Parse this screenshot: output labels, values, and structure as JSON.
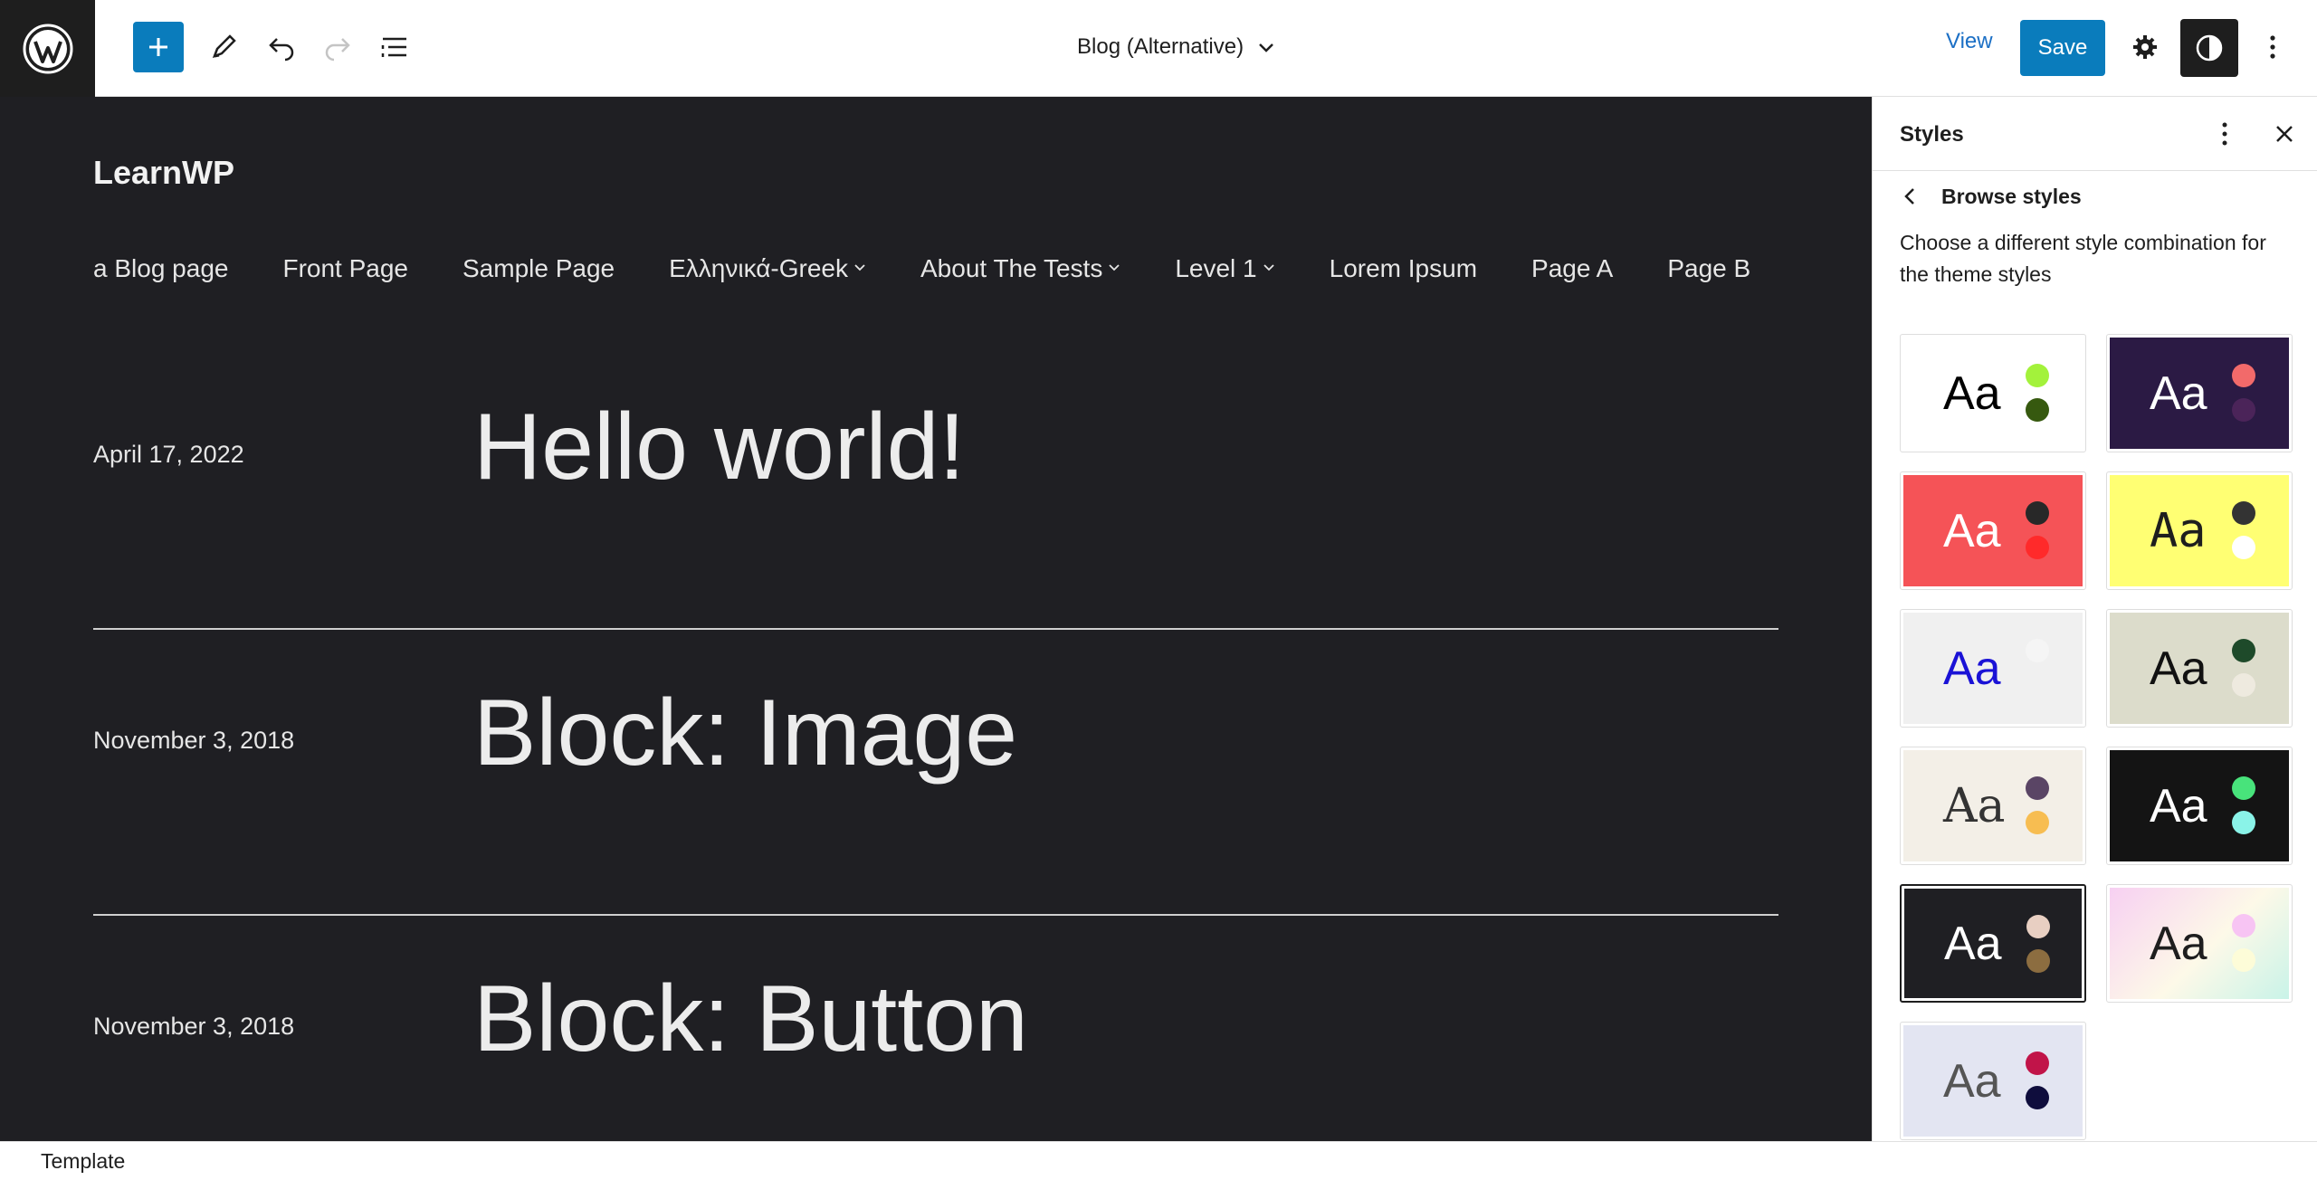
{
  "toolbar": {
    "document_title": "Blog (Alternative)",
    "view_label": "View",
    "save_label": "Save"
  },
  "site": {
    "title": "LearnWP",
    "nav": [
      {
        "label": "a Blog page",
        "has_submenu": false
      },
      {
        "label": "Front Page",
        "has_submenu": false
      },
      {
        "label": "Sample Page",
        "has_submenu": false
      },
      {
        "label": "Ελληνικά-Greek",
        "has_submenu": true
      },
      {
        "label": "About The Tests",
        "has_submenu": true
      },
      {
        "label": "Level 1",
        "has_submenu": true
      },
      {
        "label": "Lorem Ipsum",
        "has_submenu": false
      },
      {
        "label": "Page A",
        "has_submenu": false
      },
      {
        "label": "Page B",
        "has_submenu": false
      }
    ],
    "posts": [
      {
        "date": "April 17, 2022",
        "title": "Hello world!"
      },
      {
        "date": "November 3, 2018",
        "title": "Block: Image"
      },
      {
        "date": "November 3, 2018",
        "title": "Block: Button"
      }
    ]
  },
  "sidebar": {
    "title": "Styles",
    "subheading": "Browse styles",
    "description": "Choose a different style combination for the theme styles",
    "variations": [
      {
        "aa": "Aa",
        "bg": "#ffffff",
        "text": "#000000",
        "dot1": "#a3f23b",
        "dot2": "#36590f",
        "serif": false,
        "selected": false
      },
      {
        "aa": "Aa",
        "bg": "#2b1a44",
        "text": "#ffffff",
        "dot1": "#f26a6a",
        "dot2": "#4b2459",
        "serif": false,
        "selected": false
      },
      {
        "aa": "Aa",
        "bg": "#f55357",
        "text": "#ffffff",
        "dot1": "#282828",
        "dot2": "#ff2a2a",
        "serif": false,
        "selected": false
      },
      {
        "aa": "Aa",
        "bg": "#ffff73",
        "text": "#1e1e1e",
        "dot1": "#333333",
        "dot2": "#ffffff",
        "serif": false,
        "mono": true,
        "selected": false
      },
      {
        "aa": "Aa",
        "bg": "#f0f0f0",
        "text": "#1a12d6",
        "dot1": "#f5f5f5",
        "dot2": "#f0f0f0",
        "serif": false,
        "selected": false
      },
      {
        "aa": "Aa",
        "bg": "#dcdccb",
        "text": "#111111",
        "dot1": "#1e4a2a",
        "dot2": "#eeeadf",
        "serif": false,
        "selected": false
      },
      {
        "aa": "Aa",
        "bg": "#f3efe7",
        "text": "#333333",
        "dot1": "#5a4565",
        "dot2": "#f7bd51",
        "serif": true,
        "selected": false
      },
      {
        "aa": "Aa",
        "bg": "#141414",
        "text": "#ffffff",
        "dot1": "#48e37b",
        "dot2": "#8af3e8",
        "serif": false,
        "selected": false
      },
      {
        "aa": "Aa",
        "bg": "#1f1f23",
        "text": "#ffffff",
        "dot1": "#e8cfc2",
        "dot2": "#8c6d40",
        "serif": false,
        "selected": true
      },
      {
        "aa": "Aa",
        "bg": "#f2e6f5",
        "text": "#1e1e1e",
        "dot1": "#f7c4f3",
        "dot2": "#fdfcd8",
        "serif": false,
        "gradient": true,
        "selected": false
      },
      {
        "aa": "Aa",
        "bg": "#e3e5f2",
        "text": "#555555",
        "dot1": "#c11449",
        "dot2": "#0f0d3d",
        "serif": false,
        "selected": false
      }
    ]
  },
  "footer": {
    "breadcrumb": "Template"
  },
  "colors": {
    "accent": "#0a7cbc",
    "canvas_bg": "#1f1f23"
  }
}
